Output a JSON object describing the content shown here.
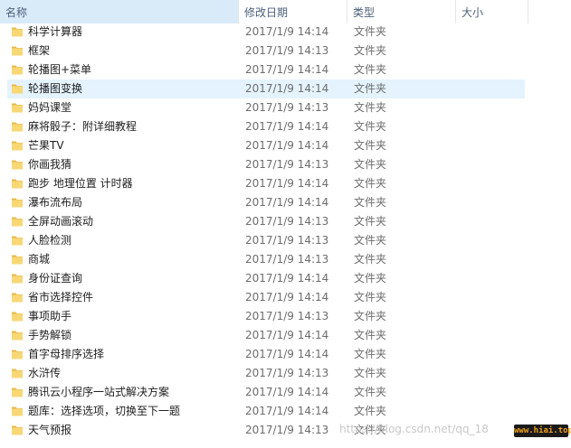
{
  "columns": {
    "name": "名称",
    "modified": "修改日期",
    "type": "类型",
    "size": "大小",
    "sort_indicator": "^"
  },
  "colors": {
    "folder": "#f8d775",
    "folder_dark": "#e8b94a",
    "hover_row": "#e5f3ff",
    "header_text": "#4c607a"
  },
  "files": [
    {
      "name": "科学计算器",
      "date": "2017/1/9 14:14",
      "type": "文件夹"
    },
    {
      "name": "框架",
      "date": "2017/1/9 14:13",
      "type": "文件夹"
    },
    {
      "name": "轮播图+菜单",
      "date": "2017/1/9 14:14",
      "type": "文件夹"
    },
    {
      "name": "轮播图变换",
      "date": "2017/1/9 14:14",
      "type": "文件夹"
    },
    {
      "name": "妈妈课堂",
      "date": "2017/1/9 14:13",
      "type": "文件夹"
    },
    {
      "name": "麻将骰子：附详细教程",
      "date": "2017/1/9 14:14",
      "type": "文件夹"
    },
    {
      "name": "芒果TV",
      "date": "2017/1/9 14:14",
      "type": "文件夹"
    },
    {
      "name": "你画我猜",
      "date": "2017/1/9 14:13",
      "type": "文件夹"
    },
    {
      "name": "跑步 地理位置 计时器",
      "date": "2017/1/9 14:14",
      "type": "文件夹"
    },
    {
      "name": "瀑布流布局",
      "date": "2017/1/9 14:14",
      "type": "文件夹"
    },
    {
      "name": "全屏动画滚动",
      "date": "2017/1/9 14:13",
      "type": "文件夹"
    },
    {
      "name": "人脸检测",
      "date": "2017/1/9 14:13",
      "type": "文件夹"
    },
    {
      "name": "商城",
      "date": "2017/1/9 14:13",
      "type": "文件夹"
    },
    {
      "name": "身份证查询",
      "date": "2017/1/9 14:14",
      "type": "文件夹"
    },
    {
      "name": "省市选择控件",
      "date": "2017/1/9 14:14",
      "type": "文件夹"
    },
    {
      "name": "事项助手",
      "date": "2017/1/9 14:13",
      "type": "文件夹"
    },
    {
      "name": "手势解锁",
      "date": "2017/1/9 14:14",
      "type": "文件夹"
    },
    {
      "name": "首字母排序选择",
      "date": "2017/1/9 14:14",
      "type": "文件夹"
    },
    {
      "name": "水浒传",
      "date": "2017/1/9 14:13",
      "type": "文件夹"
    },
    {
      "name": "腾讯云小程序一站式解决方案",
      "date": "2017/1/9 14:14",
      "type": "文件夹"
    },
    {
      "name": "题库：选择选项，切换至下一题",
      "date": "2017/1/9 14:14",
      "type": "文件夹"
    },
    {
      "name": "天气预报",
      "date": "2017/1/9 14:13",
      "type": "文件夹"
    }
  ],
  "hovered_index": 3,
  "watermark": {
    "text": "https://blog.csdn.net/qq_18",
    "logo": "www.hiai.top"
  }
}
